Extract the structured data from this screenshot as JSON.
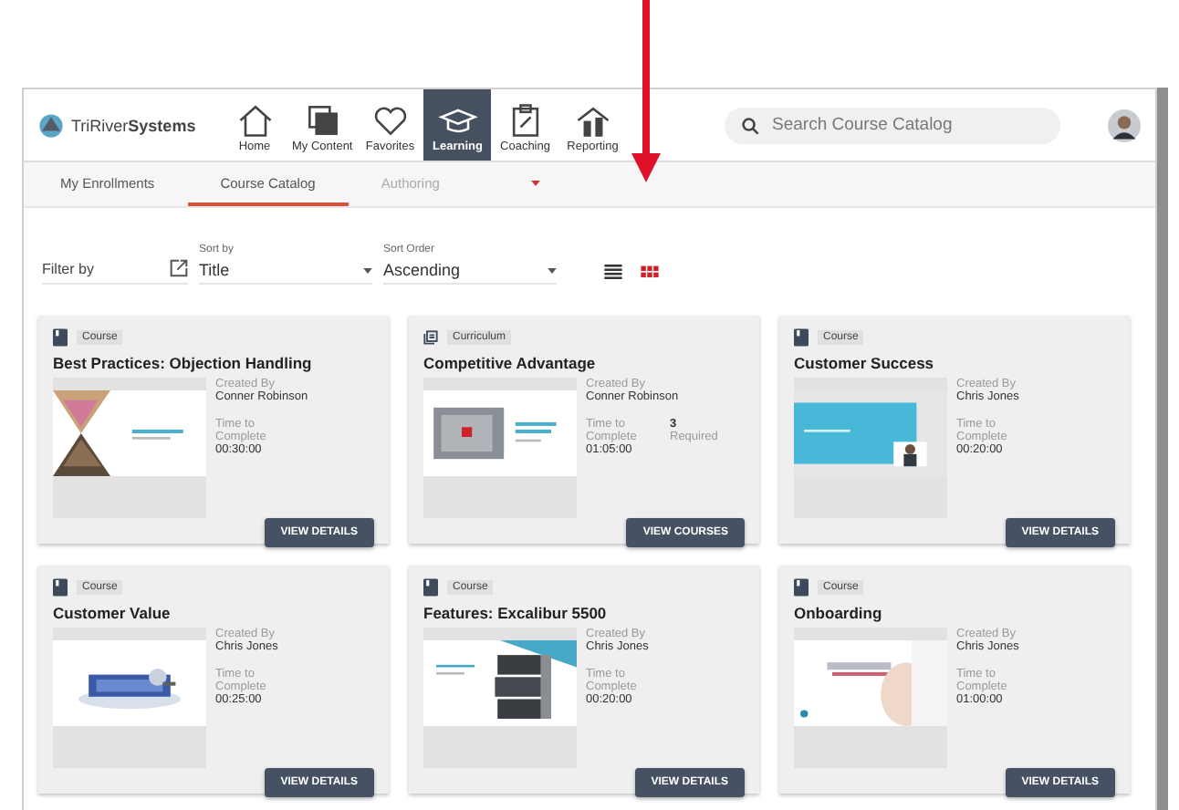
{
  "header": {
    "logo": "TriRiver**Systems**",
    "nav": [
      {
        "label": "Home",
        "selected": false
      },
      {
        "label": "My Content",
        "selected": false
      },
      {
        "label": "Favorites",
        "selected": false
      },
      {
        "label": "Learning",
        "selected": true
      },
      {
        "label": "Coaching",
        "selected": false
      },
      {
        "label": "Reporting",
        "selected": false
      }
    ],
    "search": {
      "placeholder": "Search Course Catalog"
    }
  },
  "tabs": [
    {
      "label": "My Enrollments",
      "selected": false,
      "disabled": false,
      "dropdown": false
    },
    {
      "label": "Course Catalog",
      "selected": true,
      "disabled": false,
      "dropdown": false
    },
    {
      "label": "Authoring",
      "selected": false,
      "disabled": true,
      "dropdown": true
    }
  ],
  "filters": {
    "filter_label": "Filter by",
    "sort_by": {
      "label": "Sort by",
      "value": "Title"
    },
    "sort_order": {
      "label": "Sort Order",
      "value": "Ascending"
    },
    "view_toggle": [
      {
        "kind": "list",
        "selected": false
      },
      {
        "kind": "grid",
        "selected": true
      }
    ]
  },
  "cards": [
    {
      "kind": "course",
      "type": "Course",
      "title": "Best Practices: Objection Handling",
      "created_label": "Created By",
      "author": "Conner Robinson",
      "time_label": "Time to Complete",
      "time": "00:30:00",
      "button": "VIEW DETAILS"
    },
    {
      "kind": "curriculum",
      "type": "Curriculum",
      "title": "Competitive Advantage",
      "created_label": "Created By",
      "author": "Conner Robinson",
      "time_label": "Time to Complete",
      "time": "01:05:00",
      "required_count": "3",
      "required_label": "Required",
      "button": "VIEW COURSES"
    },
    {
      "kind": "course",
      "type": "Course",
      "title": "Customer Success",
      "created_label": "Created By",
      "author": "Chris Jones",
      "time_label": "Time to Complete",
      "time": "00:20:00",
      "button": "VIEW DETAILS"
    },
    {
      "kind": "course",
      "type": "Course",
      "title": "Customer Value",
      "created_label": "Created By",
      "author": "Chris Jones",
      "time_label": "Time to Complete",
      "time": "00:25:00",
      "button": "VIEW DETAILS"
    },
    {
      "kind": "course",
      "type": "Course",
      "title": "Features: Excalibur 5500",
      "created_label": "Created By",
      "author": "Chris Jones",
      "time_label": "Time to Complete",
      "time": "00:20:00",
      "button": "VIEW DETAILS"
    },
    {
      "kind": "course",
      "type": "Course",
      "title": "Onboarding",
      "created_label": "Created By",
      "author": "Chris Jones",
      "time_label": "Time to Complete",
      "time": "01:00:00",
      "button": "VIEW DETAILS"
    }
  ]
}
